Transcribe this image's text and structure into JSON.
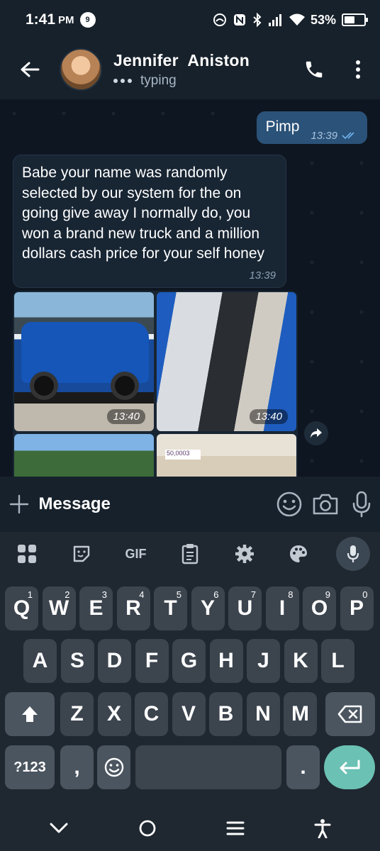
{
  "status": {
    "time": "1:41",
    "ampm": "PM",
    "notif_badge": "9",
    "battery": "53%",
    "battery_level": 0.53
  },
  "header": {
    "name": "Jennifer  Aniston",
    "status": "typing"
  },
  "messages": {
    "outgoing": {
      "text": "Pimp",
      "time": "13:39"
    },
    "incoming": {
      "text": "Babe your name was randomly selected by our system for the on going give away I normally do, you won a brand new truck and a million dollars cash price for your self honey",
      "time": "13:39"
    },
    "album": {
      "times": [
        "13:40",
        "13:40"
      ],
      "slip_text": "50,0003"
    }
  },
  "input": {
    "placeholder": "Message"
  },
  "keyboard": {
    "toolbar": {
      "gif": "GIF"
    },
    "row1": [
      "Q",
      "W",
      "E",
      "R",
      "T",
      "Y",
      "U",
      "I",
      "O",
      "P"
    ],
    "row1_hints": [
      "1",
      "2",
      "3",
      "4",
      "5",
      "6",
      "7",
      "8",
      "9",
      "0"
    ],
    "row2": [
      "A",
      "S",
      "D",
      "F",
      "G",
      "H",
      "J",
      "K",
      "L"
    ],
    "row3": [
      "Z",
      "X",
      "C",
      "V",
      "B",
      "N",
      "M"
    ],
    "row4": {
      "symbols": "?123",
      "comma": ",",
      "period": "."
    }
  },
  "colors": {
    "header_bg": "#17212b",
    "chat_bg": "#0e1621",
    "outgoing_bubble": "#2b5278",
    "incoming_bubble": "#182533",
    "enter_key": "#6bc1b4"
  }
}
